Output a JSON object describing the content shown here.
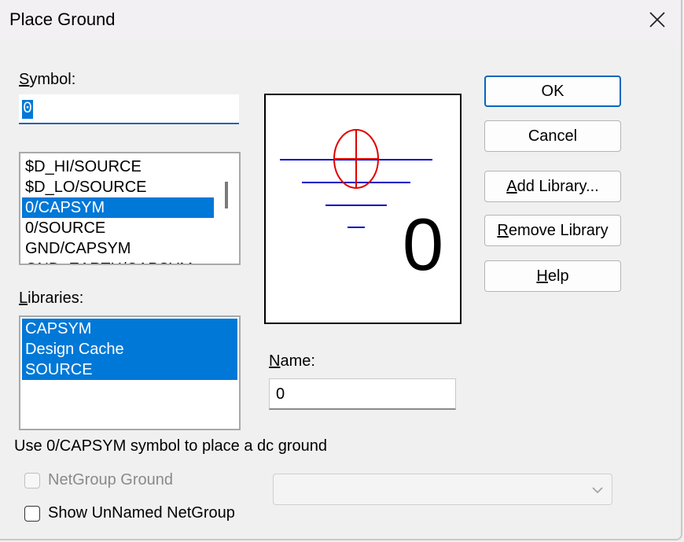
{
  "window": {
    "title": "Place Ground"
  },
  "symbol": {
    "label_prefix": "",
    "label_ul": "S",
    "label_rest": "ymbol:",
    "value": "0"
  },
  "symbol_list": {
    "items": [
      "$D_HI/SOURCE",
      "$D_LO/SOURCE",
      "0/CAPSYM",
      "0/SOURCE",
      "GND/CAPSYM",
      "GND_EARTH/CAPSYM"
    ],
    "selected_index": 2
  },
  "libraries": {
    "label_ul": "L",
    "label_rest": "ibraries:",
    "items": [
      "CAPSYM",
      "Design Cache",
      "SOURCE"
    ]
  },
  "preview": {
    "name_text": "0"
  },
  "buttons": {
    "ok": "OK",
    "cancel": "Cancel",
    "add_library_ul": "A",
    "add_library_rest": "dd Library...",
    "remove_library_ul": "R",
    "remove_library_rest": "emove Library",
    "help_ul": "H",
    "help_rest": "elp"
  },
  "name": {
    "label_ul": "N",
    "label_rest": "ame:",
    "value": "0"
  },
  "status_text": "Use 0/CAPSYM symbol to place a dc ground",
  "options": {
    "netgroup_ground": "NetGroup Ground",
    "netgroup_ground_checked": false,
    "netgroup_ground_enabled": false,
    "show_unnamed": "Show UnNamed NetGroup",
    "show_unnamed_checked": false
  },
  "netgroup_combo": {
    "value": ""
  },
  "colors": {
    "selection": "#0078d7",
    "symbol_line": "#0000c8",
    "symbol_circle": "#e00000"
  }
}
